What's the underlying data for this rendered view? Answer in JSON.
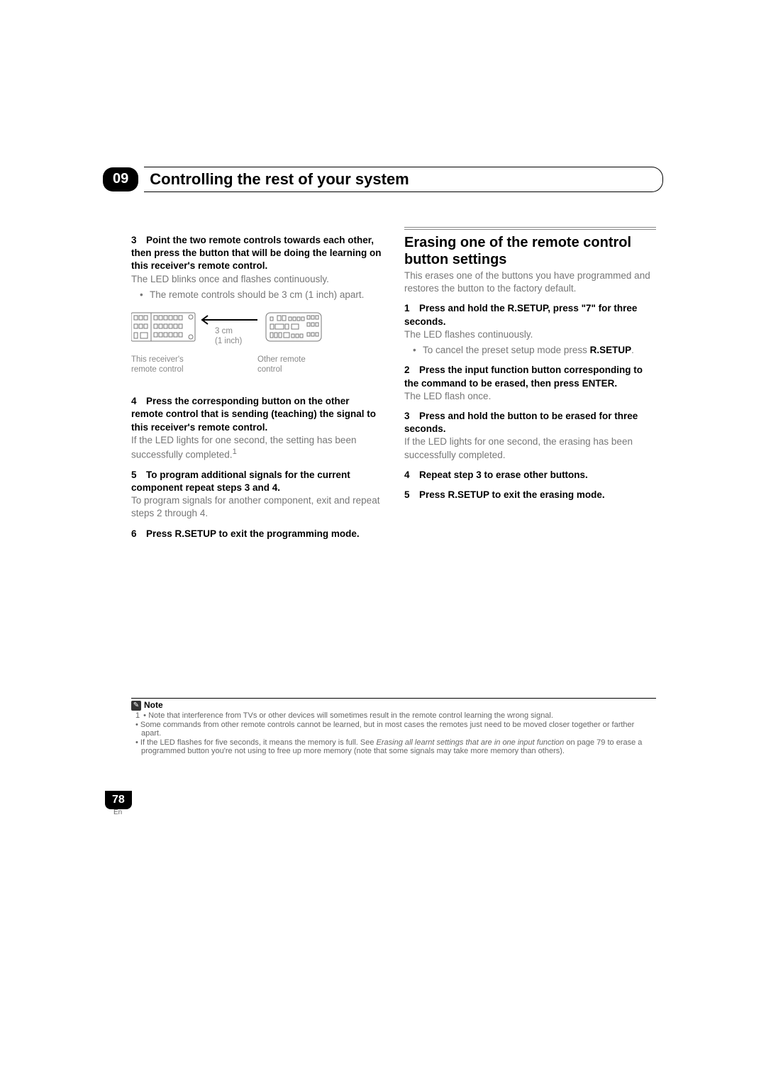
{
  "chapter": {
    "number": "09",
    "title": "Controlling the rest of your system"
  },
  "left_column": {
    "step3_bold": "3 Point the two remote controls towards each other, then press the button that will be doing the learning on this receiver's remote control.",
    "step3_gray": "The LED blinks once and flashes continuously.",
    "step3_bullet": "The remote controls should be 3 cm (1 inch) apart.",
    "diagram": {
      "distance": "3 cm",
      "distance_sub": "(1 inch)",
      "label_left": "This receiver's remote control",
      "label_right": "Other remote control"
    },
    "step4_bold": "4 Press the corresponding button on the other remote control that is sending (teaching) the signal to this receiver's remote control.",
    "step4_gray": "If the LED lights for one second, the setting has been successfully completed.",
    "step4_fn": "1",
    "step5_bold": "5 To program additional signals for the current component repeat steps 3 and 4.",
    "step5_gray": "To program signals for another component, exit and repeat steps 2 through 4.",
    "step6_bold": "6 Press R.SETUP to exit the programming mode."
  },
  "right_column": {
    "heading": "Erasing one of the remote control button settings",
    "intro_gray": "This erases one of the buttons you have programmed and restores the button to the factory default.",
    "step1_bold": "1 Press and hold the R.SETUP, press \"7\" for three seconds.",
    "step1_gray": "The LED flashes continuously.",
    "step1_bullet_pre": "To cancel the preset setup mode press ",
    "step1_bullet_bold": "R.SETUP",
    "step1_bullet_post": ".",
    "step2_bold": "2 Press the input function button corresponding to the command to be erased, then press ENTER.",
    "step2_gray": "The LED flash once.",
    "step3_bold": "3 Press and hold the button to be erased for three seconds.",
    "step3_gray": "If the LED lights for one second, the erasing has been successfully completed.",
    "step4_bold": "4 Repeat step 3 to erase other buttons.",
    "step5_bold": "5 Press R.SETUP to exit the erasing mode."
  },
  "notes": {
    "label": "Note",
    "fnum": "1",
    "n1": "Note that interference from TVs or other devices will sometimes result in the remote control learning the wrong signal.",
    "n2": "Some commands from other remote controls cannot be learned, but in most cases the remotes just need to be moved closer together or farther apart.",
    "n3_pre": "If the LED flashes for five seconds, it means the memory is full. See ",
    "n3_italic": "Erasing all learnt settings that are in one input function",
    "n3_post": " on page 79 to erase a programmed button you're not using to free up more memory (note that some signals may take more memory than others)."
  },
  "page": {
    "number": "78",
    "lang": "En"
  }
}
